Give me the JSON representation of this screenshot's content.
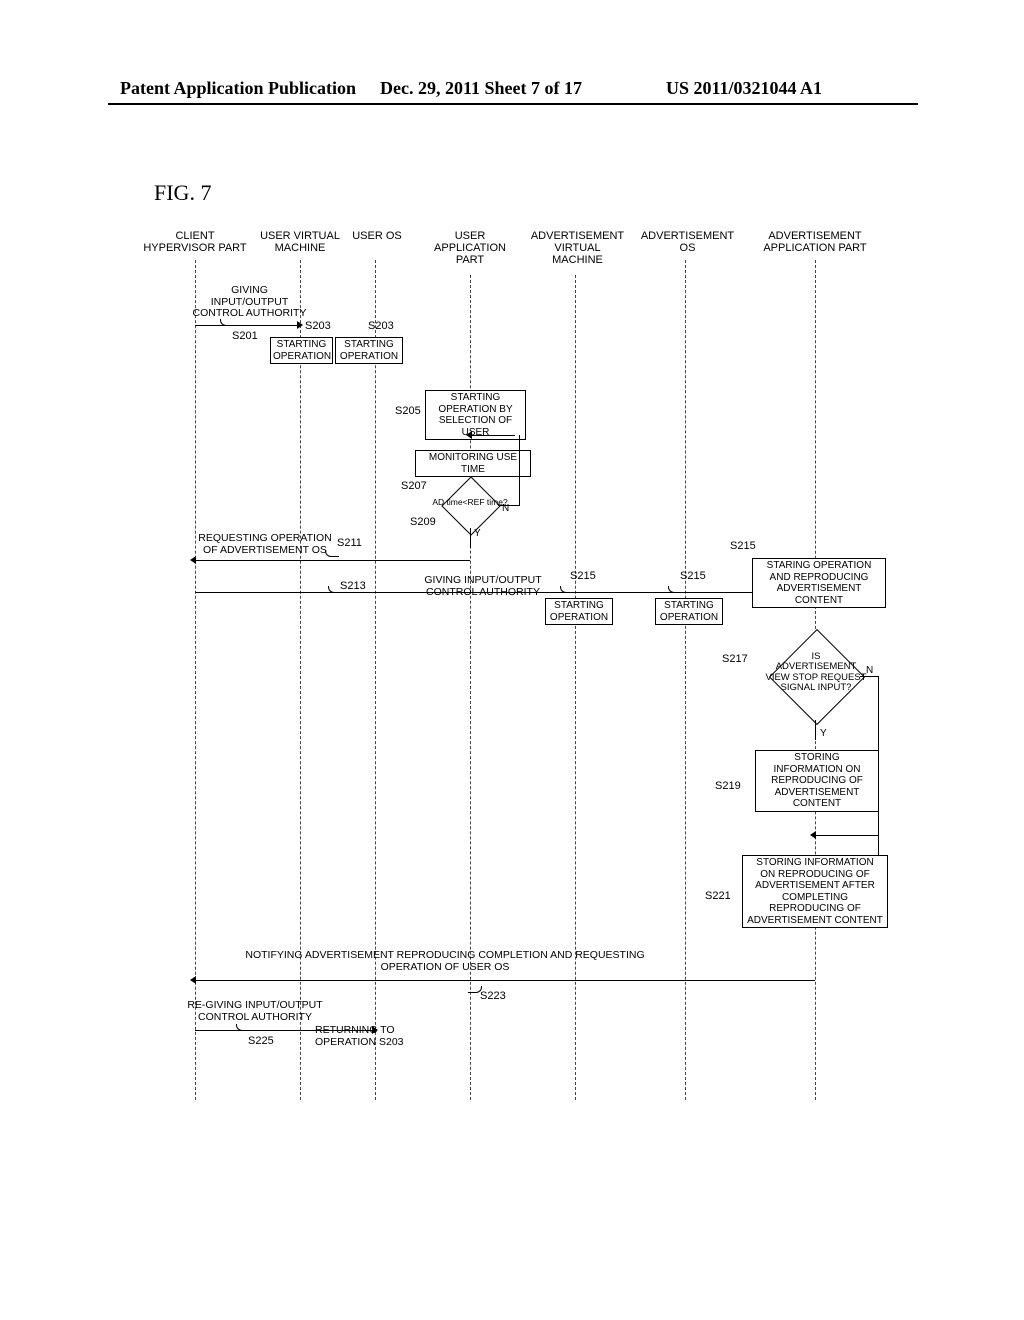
{
  "header": {
    "left": "Patent Application Publication",
    "center": "Dec. 29, 2011  Sheet 7 of 17",
    "right": "US 2011/0321044 A1"
  },
  "figure_title": "FIG. 7",
  "lanes": {
    "client_hypervisor": "CLIENT\nHYPERVISOR PART",
    "user_vm": "USER VIRTUAL\nMACHINE",
    "user_os": "USER OS",
    "user_app": "USER\nAPPLICATION\nPART",
    "ad_vm": "ADVERTISEMENT\nVIRTUAL\nMACHINE",
    "ad_os": "ADVERTISEMENT\nOS",
    "ad_app": "ADVERTISEMENT\nAPPLICATION PART"
  },
  "msgs": {
    "give_io": "GIVING INPUT/OUTPUT\nCONTROL AUTHORITY",
    "s201": "S201",
    "s203": "S203",
    "starting_op": "STARTING\nOPERATION",
    "s205": "S205",
    "start_by_user": "STARTING\nOPERATION BY\nSELECTION OF USER",
    "monitor": "MONITORING USE TIME",
    "s207": "S207",
    "s209": "S209",
    "ad_ref": "AD time<REF time?",
    "n": "N",
    "y": "Y",
    "req_ad_os": "REQUESTING OPERATION\nOF ADVERTISEMENT OS",
    "s211": "S211",
    "s213": "S213",
    "give_io2": "GIVING INPUT/OUTPUT\nCONTROL AUTHORITY",
    "s215": "S215",
    "start_repro": "STARING OPERATION\nAND REPRODUCING\nADVERTISEMENT\nCONTENT",
    "s217": "S217",
    "stop_req": "IS\nADVERTISEMENT\nVIEW STOP REQUEST\nSIGNAL INPUT?",
    "s219": "S219",
    "store_info": "STORING\nINFORMATION ON\nREPRODUCING OF\nADVERTISEMENT\nCONTENT",
    "s221": "S221",
    "store_after": "STORING INFORMATION\nON REPRODUCING OF\nADVERTISEMENT AFTER\nCOMPLETING\nREPRODUCING OF\nADVERTISEMENT CONTENT",
    "notify": "NOTIFYING ADVERTISEMENT REPRODUCING COMPLETION AND REQUESTING\nOPERATION OF USER OS",
    "s223": "S223",
    "regive_io": "RE-GIVING INPUT/OUTPUT\nCONTROL AUTHORITY",
    "s225": "S225",
    "return203": "RETURNING TO\nOPERATION S203"
  }
}
